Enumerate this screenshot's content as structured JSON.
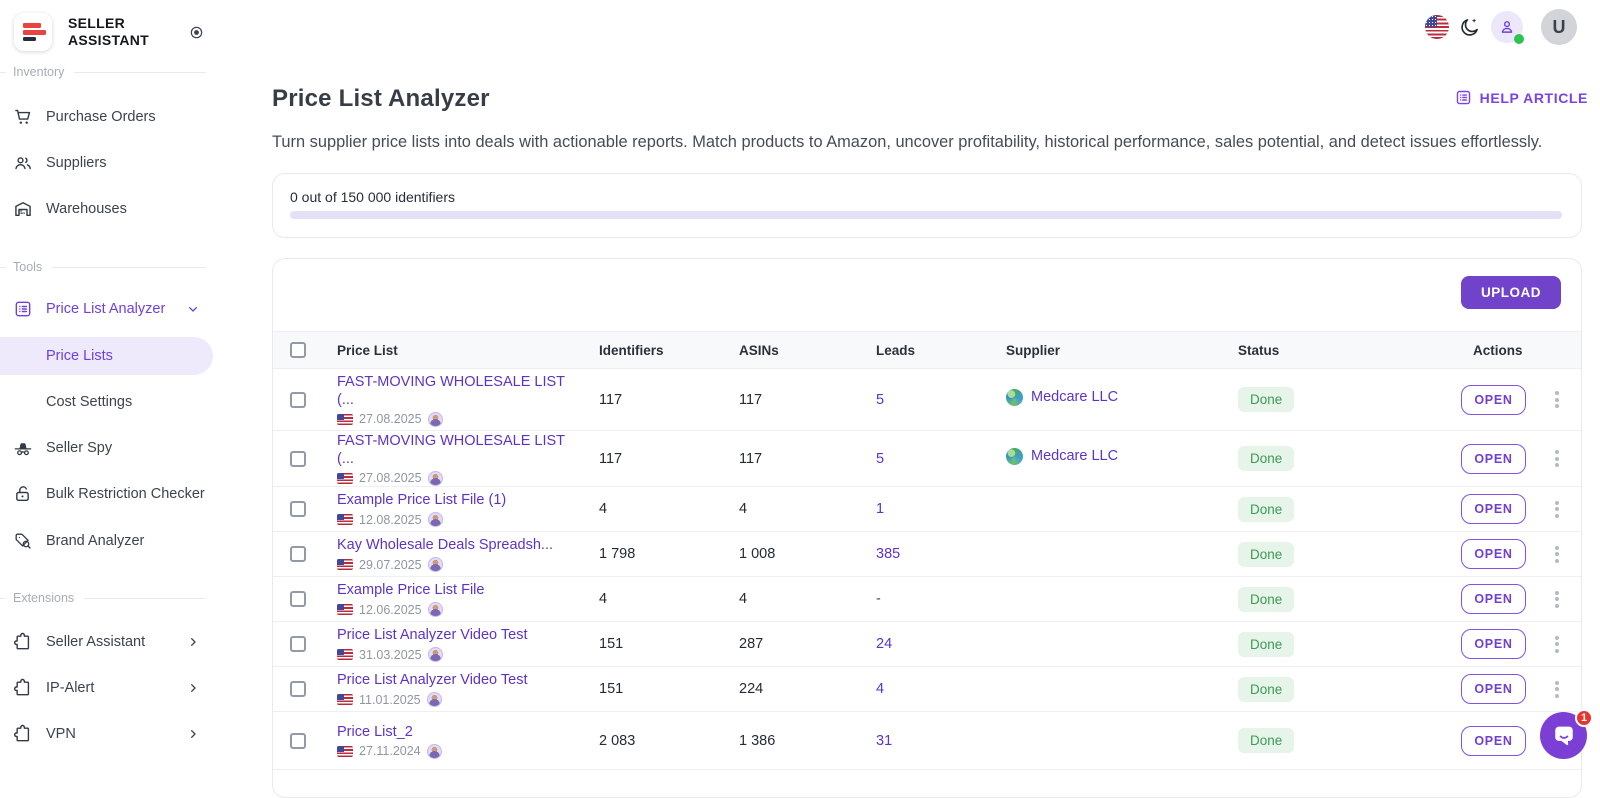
{
  "brand": {
    "line1": "SELLER",
    "line2": "ASSISTANT"
  },
  "colors": {
    "accent_purple": "#7142ca",
    "link_purple": "#5d33c7",
    "done_green": "#3e9a56",
    "logo_red": "#e8433f",
    "badge_red": "#e8352e"
  },
  "sidebar": {
    "sections": [
      {
        "label": "Inventory",
        "items": [
          {
            "label": "Purchase Orders",
            "icon": "cart-icon"
          },
          {
            "label": "Suppliers",
            "icon": "people-icon"
          },
          {
            "label": "Warehouses",
            "icon": "warehouse-icon"
          }
        ]
      },
      {
        "label": "Tools",
        "items": [
          {
            "label": "Price List Analyzer",
            "icon": "price-list-icon",
            "active": true,
            "expanded": true,
            "children": [
              {
                "label": "Price Lists",
                "selected": true
              },
              {
                "label": "Cost Settings",
                "selected": false
              }
            ]
          },
          {
            "label": "Seller Spy",
            "icon": "spy-icon"
          },
          {
            "label": "Bulk Restriction Checker",
            "icon": "lock-open-icon"
          },
          {
            "label": "Brand Analyzer",
            "icon": "tag-search-icon"
          }
        ]
      },
      {
        "label": "Extensions",
        "items": [
          {
            "label": "Seller Assistant",
            "icon": "puzzle-icon"
          },
          {
            "label": "IP-Alert",
            "icon": "puzzle-icon"
          },
          {
            "label": "VPN",
            "icon": "puzzle-icon"
          }
        ]
      }
    ]
  },
  "topbar": {
    "avatar_letter": "U"
  },
  "page": {
    "title": "Price List Analyzer",
    "help_link": "HELP ARTICLE",
    "description": "Turn supplier price lists into deals with actionable reports. Match products to Amazon, uncover profitability, historical performance, sales potential, and detect issues effortlessly.",
    "quota": {
      "text": "0 out of 150 000 identifiers",
      "progress_percent": 0
    },
    "upload_label": "UPLOAD"
  },
  "table": {
    "columns": [
      "Price List",
      "Identifiers",
      "ASINs",
      "Leads",
      "Supplier",
      "Status",
      "Actions"
    ],
    "open_label": "OPEN",
    "rows": [
      {
        "name": "FAST-MOVING WHOLESALE LIST (...",
        "date": "27.08.2025",
        "identifiers": "117",
        "asins": "117",
        "leads": "5",
        "supplier": "Medcare LLC",
        "status": "Done"
      },
      {
        "name": "FAST-MOVING WHOLESALE LIST (...",
        "date": "27.08.2025",
        "identifiers": "117",
        "asins": "117",
        "leads": "5",
        "supplier": "Medcare LLC",
        "status": "Done"
      },
      {
        "name": "Example Price List File (1)",
        "date": "12.08.2025",
        "identifiers": "4",
        "asins": "4",
        "leads": "1",
        "supplier": "",
        "status": "Done"
      },
      {
        "name": "Kay Wholesale Deals Spreadsh...",
        "date": "29.07.2025",
        "identifiers": "1 798",
        "asins": "1 008",
        "leads": "385",
        "supplier": "",
        "status": "Done"
      },
      {
        "name": "Example Price List File",
        "date": "12.06.2025",
        "identifiers": "4",
        "asins": "4",
        "leads": "-",
        "supplier": "",
        "status": "Done"
      },
      {
        "name": "Price List Analyzer Video Test",
        "date": "31.03.2025",
        "identifiers": "151",
        "asins": "287",
        "leads": "24",
        "supplier": "",
        "status": "Done"
      },
      {
        "name": "Price List Analyzer Video Test",
        "date": "11.01.2025",
        "identifiers": "151",
        "asins": "224",
        "leads": "4",
        "supplier": "",
        "status": "Done"
      },
      {
        "name": "Price List_2",
        "date": "27.11.2024",
        "identifiers": "2 083",
        "asins": "1 386",
        "leads": "31",
        "supplier": "",
        "status": "Done"
      }
    ]
  },
  "chat": {
    "badge": "1"
  }
}
